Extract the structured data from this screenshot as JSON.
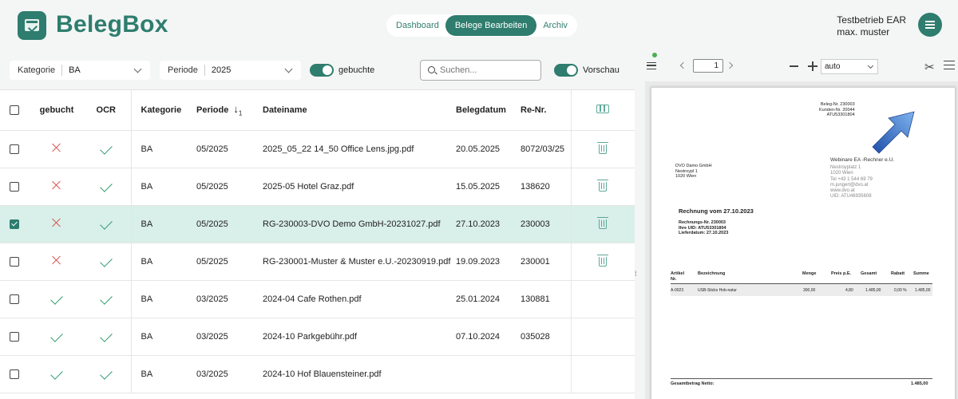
{
  "app": {
    "logo_text": "BelegBox",
    "brand_color": "#2e7d6e"
  },
  "nav": {
    "items": [
      {
        "label": "Dashboard",
        "active": false
      },
      {
        "label": "Belege Bearbeiten",
        "active": true
      },
      {
        "label": "Archiv",
        "active": false
      }
    ]
  },
  "user": {
    "company": "Testbetrieb EAR",
    "name": "max. muster",
    "avatar_icon": "menu-icon"
  },
  "filters": {
    "kategorie_label": "Kategorie",
    "kategorie_value": "BA",
    "periode_label": "Periode",
    "periode_value": "2025",
    "gebuchte_label": "gebuchte",
    "gebuchte_on": true,
    "search_placeholder": "Suchen...",
    "vorschau_label": "Vorschau",
    "vorschau_on": true
  },
  "table": {
    "headers": {
      "gebucht": "gebucht",
      "ocr": "OCR",
      "kategorie": "Kategorie",
      "periode": "Periode",
      "sort_arrow": "↓",
      "sort_index": "1",
      "dateiname": "Dateiname",
      "belegdatum": "Belegdatum",
      "renr": "Re-Nr."
    },
    "rows": [
      {
        "checked": false,
        "gebucht": false,
        "ocr": true,
        "kategorie": "BA",
        "periode": "05/2025",
        "dateiname": "2025_05_22 14_50 Office Lens.jpg.pdf",
        "belegdatum": "20.05.2025",
        "renr": "8072/03/25",
        "trash": true,
        "selected": false
      },
      {
        "checked": false,
        "gebucht": false,
        "ocr": true,
        "kategorie": "BA",
        "periode": "05/2025",
        "dateiname": "2025-05 Hotel Graz.pdf",
        "belegdatum": "15.05.2025",
        "renr": "138620",
        "trash": true,
        "selected": false
      },
      {
        "checked": true,
        "gebucht": false,
        "ocr": true,
        "kategorie": "BA",
        "periode": "05/2025",
        "dateiname": "RG-230003-DVO Demo GmbH-20231027.pdf",
        "belegdatum": "27.10.2023",
        "renr": "230003",
        "trash": true,
        "selected": true
      },
      {
        "checked": false,
        "gebucht": false,
        "ocr": true,
        "kategorie": "BA",
        "periode": "05/2025",
        "dateiname": "RG-230001-Muster & Muster e.U.-20230919.pdf",
        "belegdatum": "19.09.2023",
        "renr": "230001",
        "trash": true,
        "selected": false
      },
      {
        "checked": false,
        "gebucht": true,
        "ocr": true,
        "kategorie": "BA",
        "periode": "03/2025",
        "dateiname": "2024-04 Cafe Rothen.pdf",
        "belegdatum": "25.01.2024",
        "renr": "130881",
        "trash": false,
        "selected": false
      },
      {
        "checked": false,
        "gebucht": true,
        "ocr": true,
        "kategorie": "BA",
        "periode": "03/2025",
        "dateiname": "2024-10 Parkgebühr.pdf",
        "belegdatum": "07.10.2024",
        "renr": "035028",
        "trash": false,
        "selected": false
      },
      {
        "checked": false,
        "gebucht": true,
        "ocr": true,
        "kategorie": "BA",
        "periode": "03/2025",
        "dateiname": "2024-10 Hof Blauensteiner.pdf",
        "belegdatum": "",
        "renr": "",
        "trash": false,
        "selected": false
      }
    ]
  },
  "viewer": {
    "page_number": "1",
    "zoom_value": "auto",
    "document": {
      "ref_lines": [
        "Beleg-Nr. 230003",
        "Kunden-Nr. 20044",
        "ATU53301804"
      ],
      "sender_lines": [
        "DVO Damo GmbH",
        "Nestroypl 1",
        "1020 Wien"
      ],
      "company_name": "Webinare EA -Rechner e.U.",
      "company_lines": [
        "Nestroyplatz 1",
        "1020 Wien",
        "Tel +43 1 544 69 79",
        "m.jungert@dvo.at",
        "www.dvo.at",
        "UID: ATU46935608"
      ],
      "title": "Rechnung vom 27.10.2023",
      "meta_lines": [
        "Rechnungs-Nr. 230003",
        "Ihre UID: ATU53301804",
        "Lieferdatum: 27.10.2023"
      ],
      "table_headers": [
        "Artikel Nr.",
        "Bezeichnung",
        "Menge",
        "Preis p.E.",
        "Gesamt",
        "Rabatt",
        "Summe"
      ],
      "row": [
        "A-0023",
        "USB-Sticks Hob-natur",
        "300,00",
        "4,80",
        "1.485,00",
        "0,00 %",
        "1.485,00"
      ],
      "total_label": "Gesamtbetrag Netto:",
      "total_value": "1.485,00"
    }
  }
}
